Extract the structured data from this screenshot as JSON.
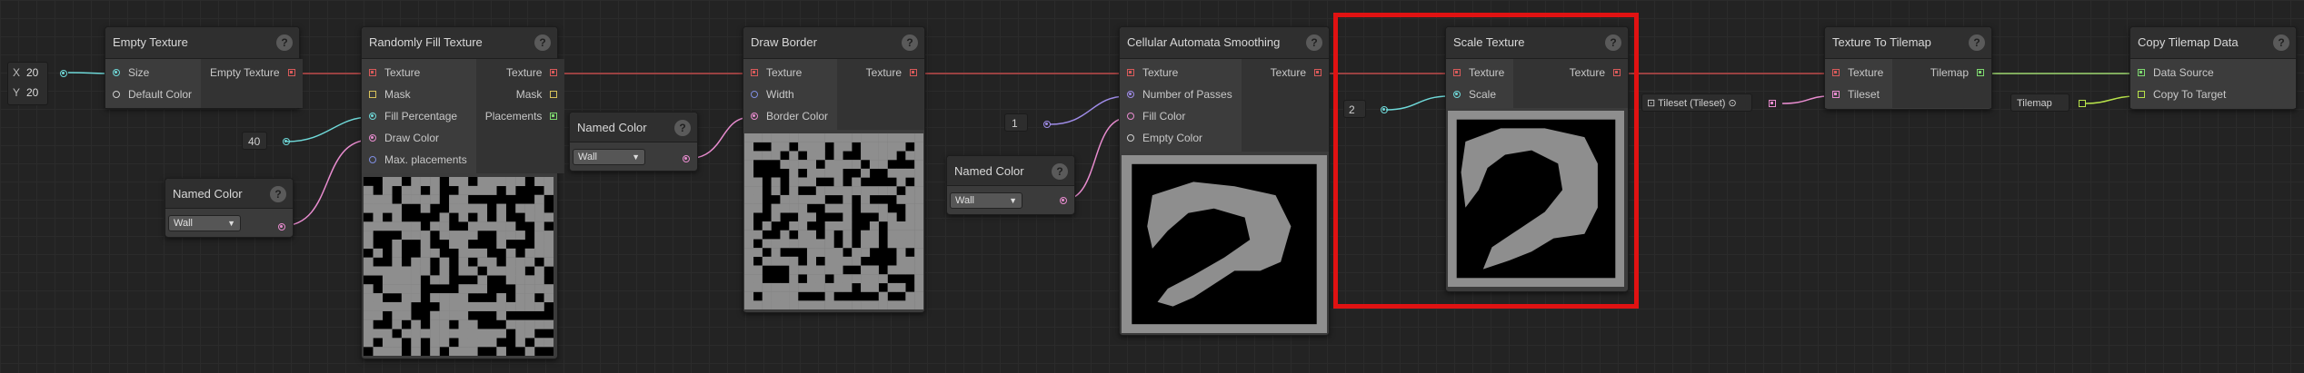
{
  "nodes": {
    "empty_texture": {
      "title": "Empty Texture",
      "help": "?",
      "inputs": [
        "Size",
        "Default Color"
      ],
      "output": "Empty Texture"
    },
    "random_fill": {
      "title": "Randomly Fill Texture",
      "help": "?",
      "inputs": [
        "Texture",
        "Mask",
        "Fill Percentage",
        "Draw Color",
        "Max. placements"
      ],
      "outputs": [
        "Texture",
        "Mask",
        "Placements"
      ]
    },
    "named_color_1": {
      "title": "Named Color",
      "help": "?",
      "value": "Wall"
    },
    "named_color_2": {
      "title": "Named Color",
      "help": "?",
      "value": "Wall"
    },
    "named_color_3": {
      "title": "Named Color",
      "help": "?",
      "value": "Wall"
    },
    "draw_border": {
      "title": "Draw Border",
      "help": "?",
      "inputs": [
        "Texture",
        "Width",
        "Border Color"
      ],
      "output": "Texture"
    },
    "ca_smoothing": {
      "title": "Cellular Automata Smoothing",
      "help": "?",
      "inputs": [
        "Texture",
        "Number of Passes",
        "Fill Color",
        "Empty Color"
      ],
      "output": "Texture"
    },
    "scale_texture": {
      "title": "Scale Texture",
      "help": "?",
      "inputs": [
        "Texture",
        "Scale"
      ],
      "output": "Texture"
    },
    "texture_to_tilemap": {
      "title": "Texture To Tilemap",
      "help": "?",
      "inputs": [
        "Texture",
        "Tileset"
      ],
      "output": "Tilemap"
    },
    "copy_tilemap": {
      "title": "Copy Tilemap Data",
      "help": "?",
      "inputs": [
        "Data Source",
        "Copy To Target"
      ]
    }
  },
  "fields": {
    "size_x_label": "X",
    "size_x": "20",
    "size_y_label": "Y",
    "size_y": "20",
    "fill_percentage": "40",
    "passes": "1",
    "scale": "2",
    "tileset": "Tileset (Tileset)",
    "tilemap": "Tilemap"
  },
  "colors": {
    "selection": "#e01212",
    "texture_wire": "#c04a4a",
    "int_wire": "#6fd9d9",
    "color_wire": "#e88ccf",
    "tilemap_wire": "#9ed86f",
    "pass_wire": "#9f8ce8"
  }
}
